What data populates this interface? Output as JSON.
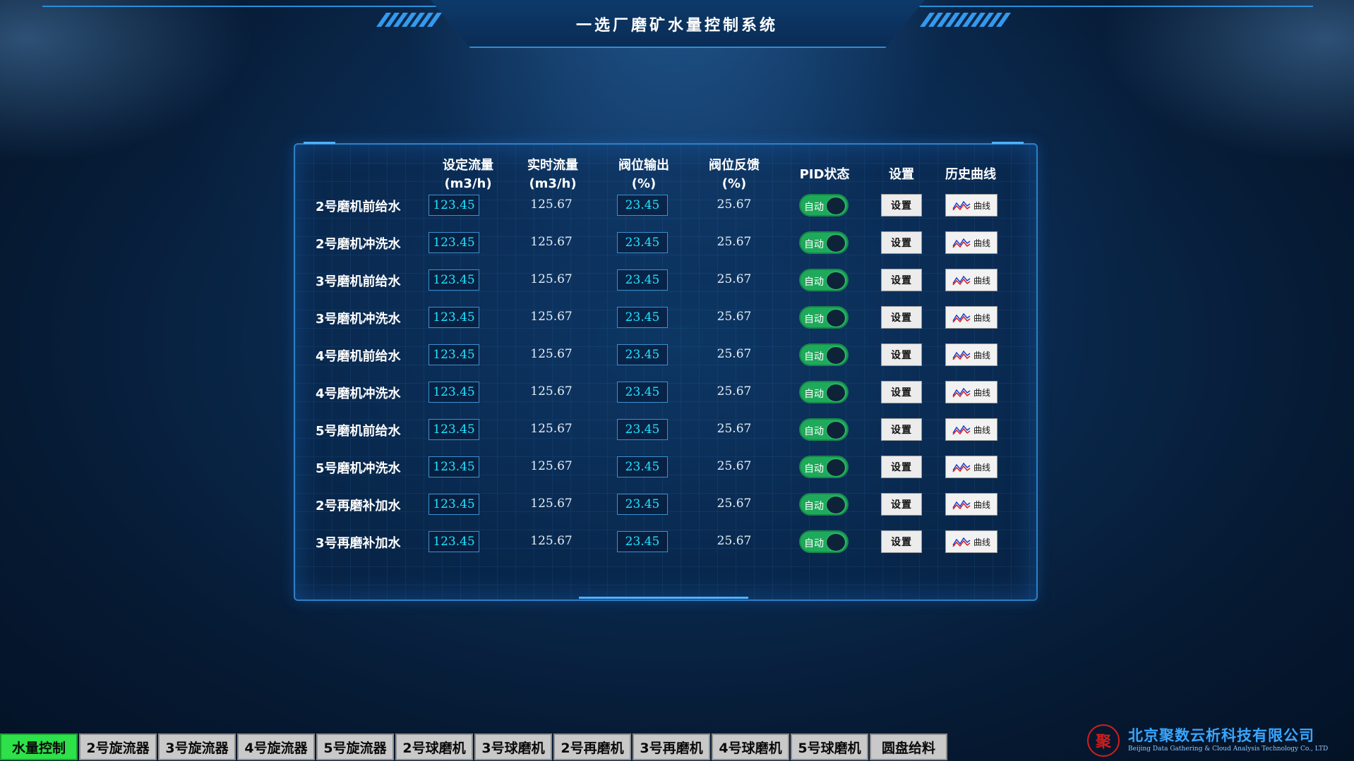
{
  "header": {
    "title": "一选厂磨矿水量控制系统"
  },
  "table": {
    "columns": {
      "set_flow": "设定流量\n(m3/h)",
      "real_flow": "实时流量\n(m3/h)",
      "valve_out": "阀位输出\n(%)",
      "valve_fb": "阀位反馈\n(%)",
      "pid": "PID状态",
      "setting": "设置",
      "history": "历史曲线"
    },
    "rows": [
      {
        "label": "2号磨机前给水",
        "set_flow": "123.45",
        "real_flow": "125.67",
        "valve_out": "23.45",
        "valve_fb": "25.67",
        "pid": "自动",
        "set_btn": "设置",
        "curve_btn": "曲线"
      },
      {
        "label": "2号磨机冲洗水",
        "set_flow": "123.45",
        "real_flow": "125.67",
        "valve_out": "23.45",
        "valve_fb": "25.67",
        "pid": "自动",
        "set_btn": "设置",
        "curve_btn": "曲线"
      },
      {
        "label": "3号磨机前给水",
        "set_flow": "123.45",
        "real_flow": "125.67",
        "valve_out": "23.45",
        "valve_fb": "25.67",
        "pid": "自动",
        "set_btn": "设置",
        "curve_btn": "曲线"
      },
      {
        "label": "3号磨机冲洗水",
        "set_flow": "123.45",
        "real_flow": "125.67",
        "valve_out": "23.45",
        "valve_fb": "25.67",
        "pid": "自动",
        "set_btn": "设置",
        "curve_btn": "曲线"
      },
      {
        "label": "4号磨机前给水",
        "set_flow": "123.45",
        "real_flow": "125.67",
        "valve_out": "23.45",
        "valve_fb": "25.67",
        "pid": "自动",
        "set_btn": "设置",
        "curve_btn": "曲线"
      },
      {
        "label": "4号磨机冲洗水",
        "set_flow": "123.45",
        "real_flow": "125.67",
        "valve_out": "23.45",
        "valve_fb": "25.67",
        "pid": "自动",
        "set_btn": "设置",
        "curve_btn": "曲线"
      },
      {
        "label": "5号磨机前给水",
        "set_flow": "123.45",
        "real_flow": "125.67",
        "valve_out": "23.45",
        "valve_fb": "25.67",
        "pid": "自动",
        "set_btn": "设置",
        "curve_btn": "曲线"
      },
      {
        "label": "5号磨机冲洗水",
        "set_flow": "123.45",
        "real_flow": "125.67",
        "valve_out": "23.45",
        "valve_fb": "25.67",
        "pid": "自动",
        "set_btn": "设置",
        "curve_btn": "曲线"
      },
      {
        "label": "2号再磨补加水",
        "set_flow": "123.45",
        "real_flow": "125.67",
        "valve_out": "23.45",
        "valve_fb": "25.67",
        "pid": "自动",
        "set_btn": "设置",
        "curve_btn": "曲线"
      },
      {
        "label": "3号再磨补加水",
        "set_flow": "123.45",
        "real_flow": "125.67",
        "valve_out": "23.45",
        "valve_fb": "25.67",
        "pid": "自动",
        "set_btn": "设置",
        "curve_btn": "曲线"
      }
    ]
  },
  "tabs": [
    {
      "label": "水量控制",
      "active": true
    },
    {
      "label": "2号旋流器",
      "active": false
    },
    {
      "label": "3号旋流器",
      "active": false
    },
    {
      "label": "4号旋流器",
      "active": false
    },
    {
      "label": "5号旋流器",
      "active": false
    },
    {
      "label": "2号球磨机",
      "active": false
    },
    {
      "label": "3号球磨机",
      "active": false
    },
    {
      "label": "2号再磨机",
      "active": false
    },
    {
      "label": "3号再磨机",
      "active": false
    },
    {
      "label": "4号球磨机",
      "active": false
    },
    {
      "label": "5号球磨机",
      "active": false
    },
    {
      "label": "圆盘给料",
      "active": false
    }
  ],
  "company": {
    "name_cn": "北京聚数云析科技有限公司",
    "name_en": "Beijing Data Gathering & Cloud Analysis Technology Co., LTD",
    "seal_char": "聚"
  },
  "colors": {
    "accent": "#22e4ff",
    "toggle_on": "#1faa5b",
    "active_tab": "#2ee04a"
  }
}
